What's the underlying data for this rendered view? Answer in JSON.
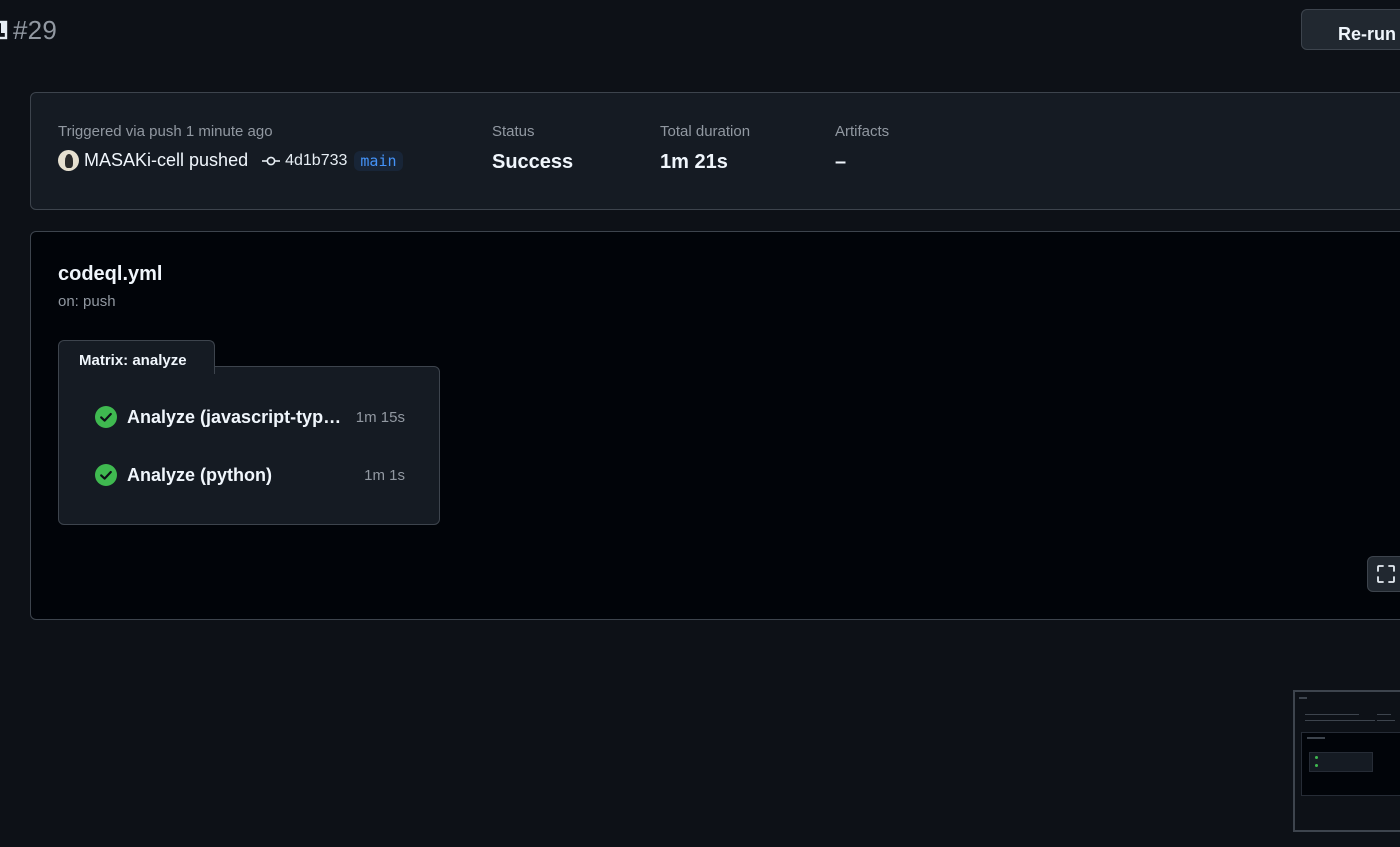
{
  "run": {
    "number": "#29"
  },
  "actions": {
    "rerun_label": "Re-run all"
  },
  "summary": {
    "trigger": "Triggered via push 1 minute ago",
    "actor": "MASAKi-cell",
    "event_verb": "pushed",
    "commit": "4d1b733",
    "branch": "main",
    "status_label": "Status",
    "status_value": "Success",
    "duration_label": "Total duration",
    "duration_value": "1m 21s",
    "artifacts_label": "Artifacts",
    "artifacts_value": "–"
  },
  "workflow": {
    "name": "codeql.yml",
    "trigger": "on: push",
    "matrix_label": "Matrix: analyze",
    "jobs": [
      {
        "name": "Analyze (javascript-typescript)",
        "duration": "1m 15s",
        "status": "success"
      },
      {
        "name": "Analyze (python)",
        "duration": "1m 1s",
        "status": "success"
      }
    ]
  },
  "colors": {
    "success": "#3fb950",
    "branch": "#4493f8",
    "muted": "#9198a1"
  },
  "icons": {
    "run": "book-icon",
    "commit": "git-commit-icon",
    "job_status": "check-circle-icon",
    "fullscreen": "fullscreen-icon"
  }
}
